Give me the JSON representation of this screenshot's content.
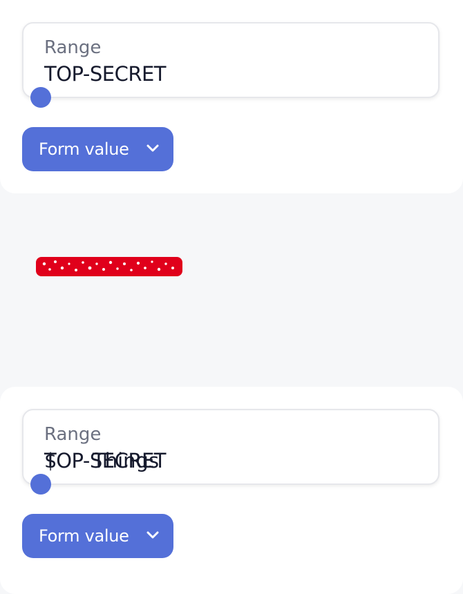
{
  "top_widget": {
    "range_label": "Range",
    "range_value": "TOP-SECRET",
    "dropdown_label": "Form value"
  },
  "redacted_stamp": {
    "icon": "redacted-scribble"
  },
  "bottom_widget": {
    "range_label": "Range",
    "range_value": "TOP-SECRET",
    "overlap_prefix": "$",
    "overlap_text": "Things",
    "dropdown_label": "Form value"
  },
  "colors": {
    "accent": "#5470d8",
    "redaction": "#e0001b"
  }
}
